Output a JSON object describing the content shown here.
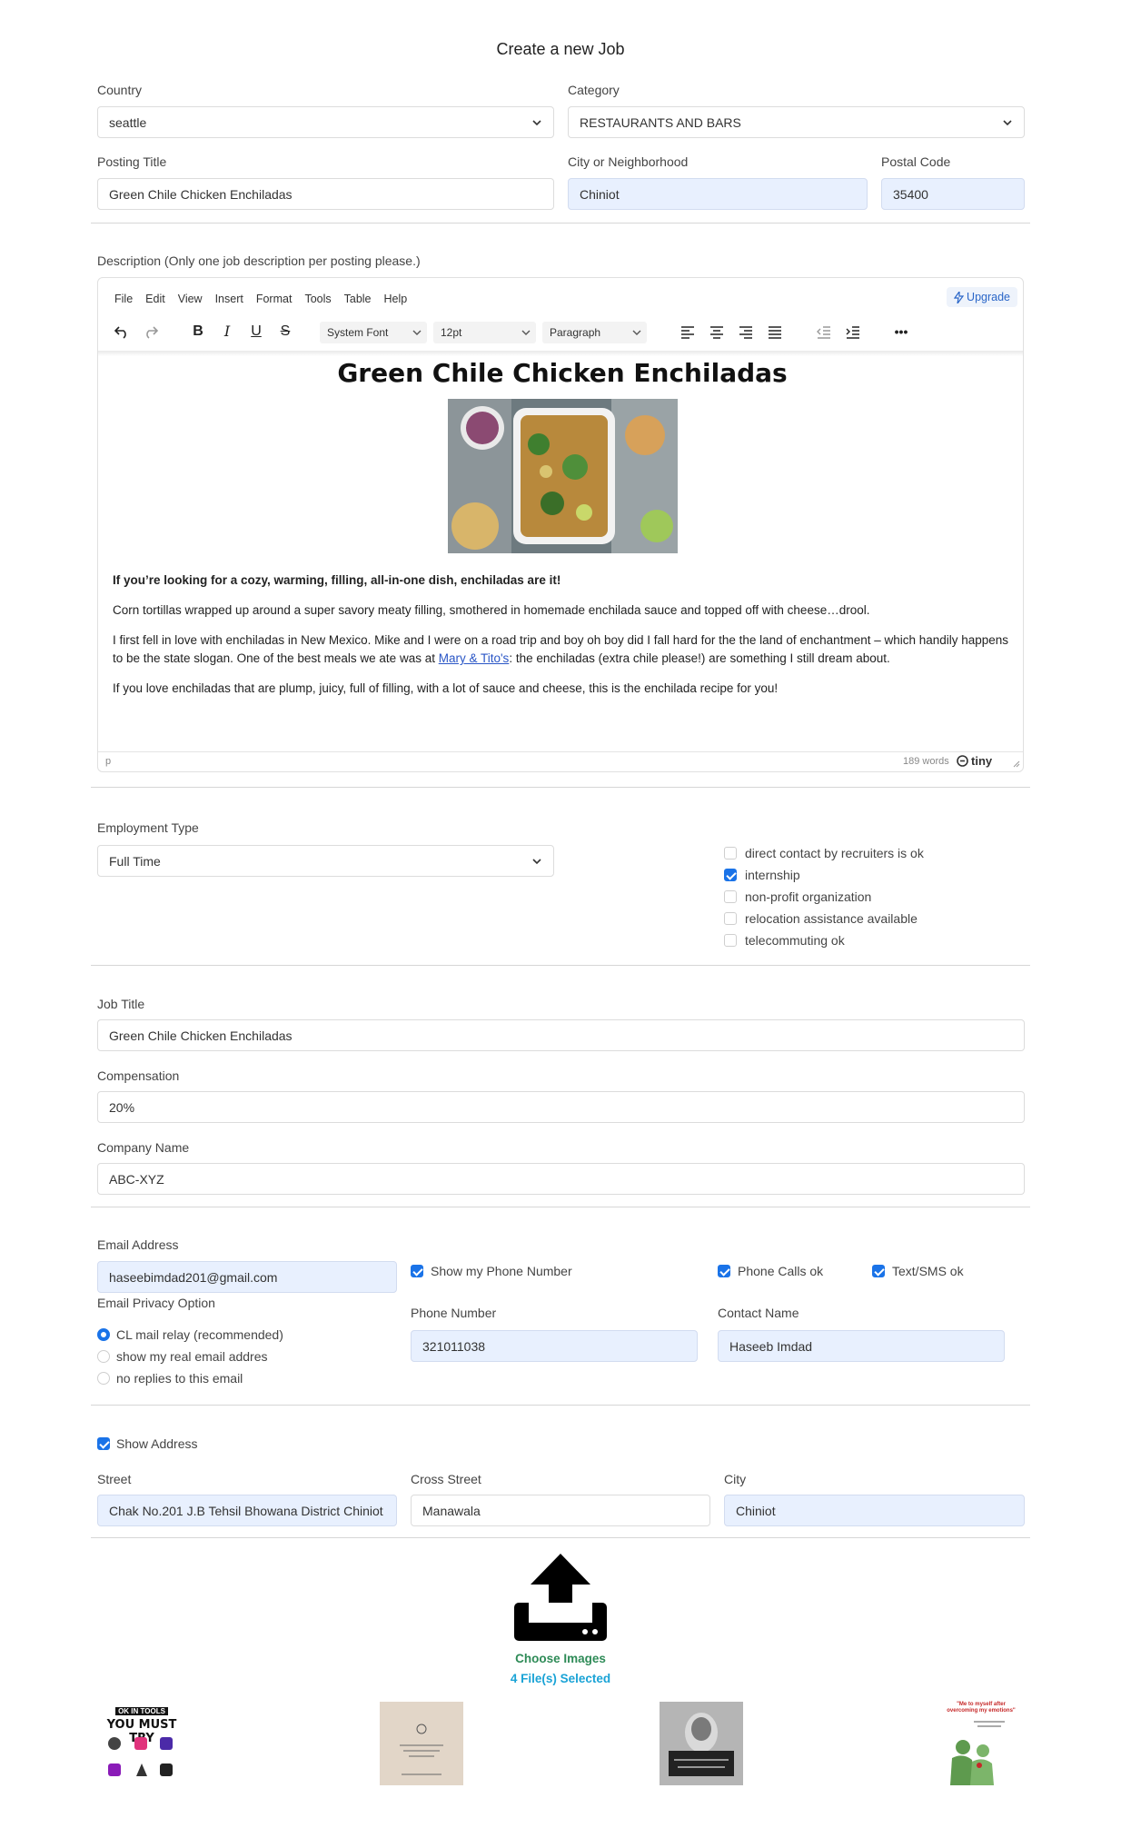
{
  "page": {
    "title": "Create a new Job"
  },
  "location": {
    "country_label": "Country",
    "country_value": "seattle",
    "category_label": "Category",
    "category_value": "RESTAURANTS AND BARS",
    "posting_title_label": "Posting Title",
    "posting_title_value": "Green Chile Chicken Enchiladas",
    "city_label": "City or Neighborhood",
    "city_value": "Chiniot",
    "postal_label": "Postal Code",
    "postal_value": "35400"
  },
  "description": {
    "label": "Description (Only one job description per posting please.)",
    "menu": [
      "File",
      "Edit",
      "View",
      "Insert",
      "Format",
      "Tools",
      "Table",
      "Help"
    ],
    "upgrade": "Upgrade",
    "font_family": "System Font",
    "font_size": "12pt",
    "block_format": "Paragraph",
    "heading": "Green Chile Chicken Enchiladas",
    "intro_bold": "If you’re looking for a cozy, warming, filling, all-in-one dish, enchiladas are it!",
    "para1": "Corn tortillas wrapped up around a super savory meaty filling, smothered in homemade enchilada sauce and topped off with cheese…drool.",
    "para2_a": "I first fell in love with enchiladas in New Mexico. Mike and I were on a road trip and boy oh boy did I fall hard for the the land of enchantment – which handily happens to be the state slogan. One of the best meals we ate was at ",
    "para2_link": "Mary & Tito's",
    "para2_b": ": the enchiladas (extra chile please!) are something I still dream about.",
    "para3": "If you love enchiladas that are plump, juicy, full of filling, with a lot of sauce and cheese, this is the enchilada recipe for you!",
    "status_path": "p",
    "word_count": "189 words",
    "brand": "tiny"
  },
  "employment": {
    "label": "Employment Type",
    "value": "Full Time",
    "options": [
      {
        "label": "direct contact by recruiters is ok",
        "checked": false
      },
      {
        "label": "internship",
        "checked": true
      },
      {
        "label": "non-profit organization",
        "checked": false
      },
      {
        "label": "relocation assistance available",
        "checked": false
      },
      {
        "label": "telecommuting ok",
        "checked": false
      }
    ]
  },
  "job": {
    "title_label": "Job Title",
    "title_value": "Green Chile Chicken Enchiladas",
    "comp_label": "Compensation",
    "comp_value": "20%",
    "company_label": "Company Name",
    "company_value": "ABC-XYZ"
  },
  "contact": {
    "email_label": "Email Address",
    "email_value": "haseebimdad201@gmail.com",
    "privacy_label": "Email Privacy Option",
    "privacy_options": [
      "CL mail relay (recommended)",
      "show my real email addres",
      "no replies to this email"
    ],
    "show_phone_label": "Show my Phone Number",
    "phone_calls_label": "Phone Calls ok",
    "text_sms_label": "Text/SMS ok",
    "phone_label": "Phone Number",
    "phone_value": "321011038",
    "contact_name_label": "Contact Name",
    "contact_name_value": "Haseeb Imdad"
  },
  "address": {
    "show_label": "Show Address",
    "street_label": "Street",
    "street_value": "Chak No.201 J.B Tehsil Bhowana District Chiniot",
    "cross_label": "Cross Street",
    "cross_value": "Manawala",
    "city_label": "City",
    "city_value": "Chiniot"
  },
  "upload": {
    "choose_label": "Choose Images",
    "selected_label": "4 File(s) Selected",
    "thumb1_lines": [
      "OK IN TOOLS",
      "YOU MUST TRY"
    ],
    "thumb4_lines": [
      "\"Me to myself after",
      "overcoming my emotions\""
    ]
  },
  "colors": {
    "accent": "#1a73e8",
    "upload_green": "#2e8b57",
    "upload_blue": "#1aa3d6",
    "filled_bg": "#e8f0fe"
  }
}
